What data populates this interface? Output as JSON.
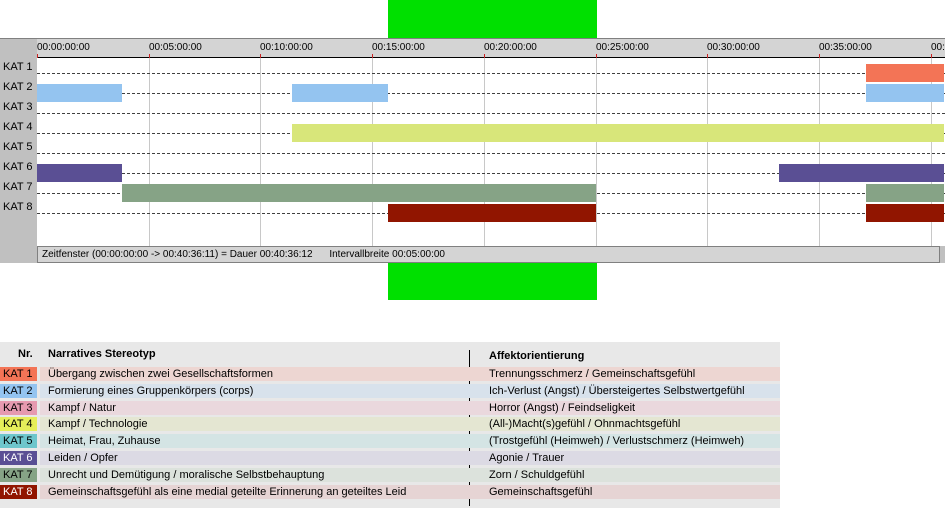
{
  "timeline": {
    "ticks": [
      "00:00:00:00",
      "00:05:00:00",
      "00:10:00:00",
      "00:15:00:00",
      "00:20:00:00",
      "00:25:00:00",
      "00:30:00:00",
      "00:35:00:00",
      "00:"
    ],
    "rows": [
      "KAT 1",
      "KAT 2",
      "KAT 3",
      "KAT 4",
      "KAT 5",
      "KAT 6",
      "KAT 7",
      "KAT 8"
    ],
    "status": {
      "zeitfenster": "Zeitfenster (00:00:00:00 -> 00:40:36:11) = Dauer 00:40:36:12",
      "intervall": "Intervallbreite 00:05:00:00"
    },
    "total_minutes": 40.6,
    "colors": {
      "KAT 1": "#f37456",
      "KAT 2": "#94c4f0",
      "KAT 3": "#e69ab0",
      "KAT 4": "#d8e67a",
      "KAT 5": "#6ec6cc",
      "KAT 6": "#5a4f94",
      "KAT 7": "#86a386",
      "KAT 8": "#911500"
    },
    "segments": [
      {
        "kat": "KAT 1",
        "start_min": 37.1,
        "end_min": 40.6
      },
      {
        "kat": "KAT 2",
        "start_min": 0.0,
        "end_min": 3.8
      },
      {
        "kat": "KAT 2",
        "start_min": 11.4,
        "end_min": 15.7
      },
      {
        "kat": "KAT 2",
        "start_min": 37.1,
        "end_min": 40.6
      },
      {
        "kat": "KAT 4",
        "start_min": 11.4,
        "end_min": 40.6
      },
      {
        "kat": "KAT 6",
        "start_min": 0.0,
        "end_min": 3.8
      },
      {
        "kat": "KAT 6",
        "start_min": 33.2,
        "end_min": 40.6
      },
      {
        "kat": "KAT 7",
        "start_min": 3.8,
        "end_min": 25.0
      },
      {
        "kat": "KAT 7",
        "start_min": 37.1,
        "end_min": 40.6
      },
      {
        "kat": "KAT 8",
        "start_min": 15.7,
        "end_min": 25.0
      },
      {
        "kat": "KAT 8",
        "start_min": 37.1,
        "end_min": 40.6
      }
    ]
  },
  "legend": {
    "header_nr": "Nr.",
    "header_stereotyp": "Narratives Stereotyp",
    "header_affekt": "Affektorientierung",
    "rows": [
      {
        "nr": "KAT 1",
        "stereotyp": "Übergang zwischen zwei Gesellschaftsformen",
        "affekt": "Trennungsschmerz / Gemeinschaftsgefühl",
        "color": "#f37456",
        "tint": "#edd6d2",
        "text": "#000000"
      },
      {
        "nr": "KAT 2",
        "stereotyp": "Formierung eines Gruppenkörpers (corps)",
        "affekt": "Ich-Verlust (Angst) / Übersteigertes Selbstwertgefühl",
        "color": "#94c4f0",
        "tint": "#d8e2ec",
        "text": "#000000"
      },
      {
        "nr": "KAT 3",
        "stereotyp": "Kampf / Natur",
        "affekt": "Horror (Angst) / Feindseligkeit",
        "color": "#e69ab0",
        "tint": "#ead8dd",
        "text": "#000000"
      },
      {
        "nr": "KAT 4",
        "stereotyp": "Kampf / Technologie",
        "affekt": "(All-)Macht(s)gefühl / Ohnmachtsgefühl",
        "color": "#e6ee5a",
        "tint": "#e4e6d2",
        "text": "#000000"
      },
      {
        "nr": "KAT 5",
        "stereotyp": "Heimat, Frau, Zuhause",
        "affekt": "(Trostgefühl (Heimweh) / Verlustschmerz (Heimweh)",
        "color": "#6ec6cc",
        "tint": "#d4e4e4",
        "text": "#000000"
      },
      {
        "nr": "KAT 6",
        "stereotyp": "Leiden / Opfer",
        "affekt": "Agonie / Trauer",
        "color": "#5a4f94",
        "tint": "#dcdae4",
        "text": "#ffffff"
      },
      {
        "nr": "KAT 7",
        "stereotyp": "Unrecht und Demütigung / moralische Selbstbehauptung",
        "affekt": "Zorn / Schuldgefühl",
        "color": "#86a386",
        "tint": "#dce2dc",
        "text": "#000000"
      },
      {
        "nr": "KAT 8",
        "stereotyp": "Gemeinschaftsgefühl als eine medial geteilte Erinnerung an geteiltes Leid",
        "affekt": "Gemeinschaftsgefühl",
        "color": "#911500",
        "tint": "#e6d4d4",
        "text": "#ffffff"
      }
    ]
  }
}
